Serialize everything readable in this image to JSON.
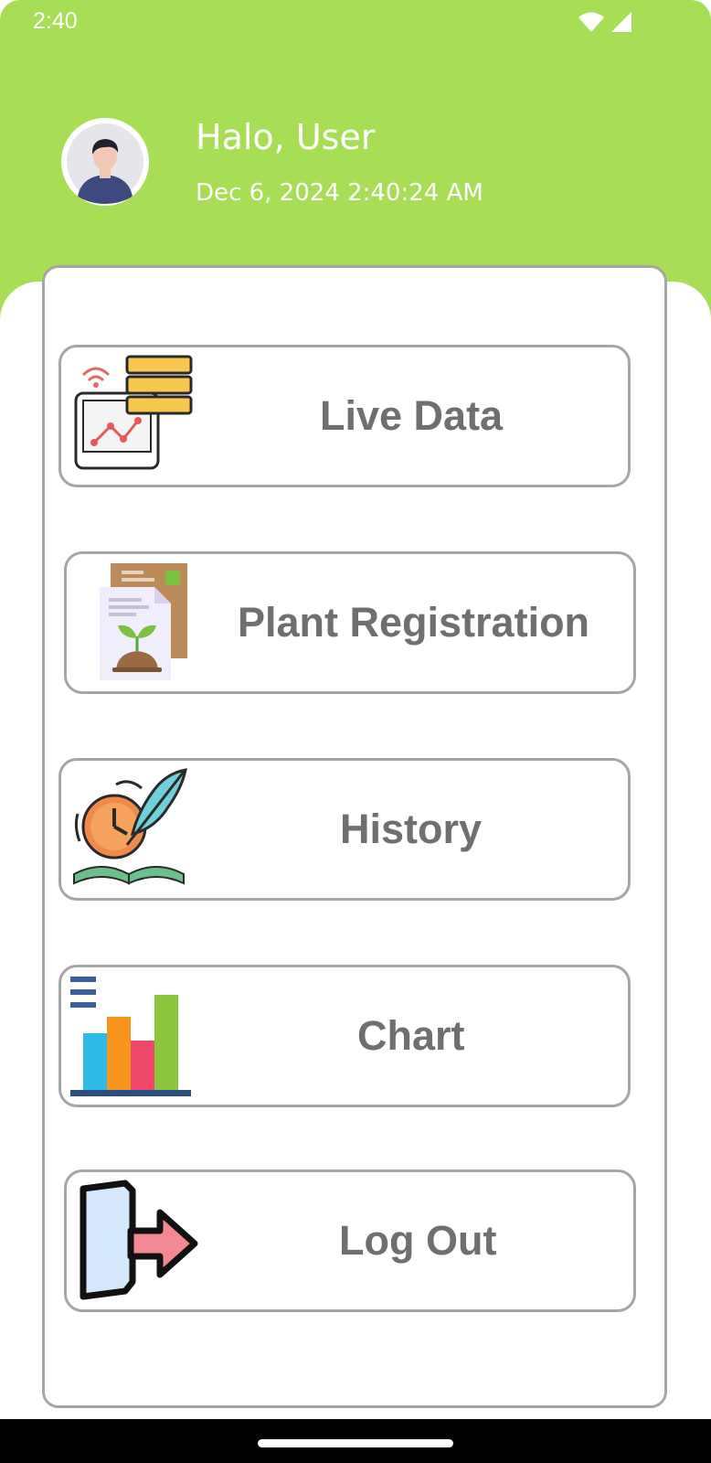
{
  "status_bar": {
    "time": "2:40",
    "icons": [
      "wifi-icon",
      "cellular-signal-icon"
    ]
  },
  "header": {
    "greeting": "Halo, User",
    "datetime": "Dec 6, 2024 2:40:24 AM",
    "avatar_icon": "user-avatar-icon"
  },
  "menu": {
    "items": [
      {
        "label": "Live Data",
        "icon": "live-data-icon"
      },
      {
        "label": "Plant Registration",
        "icon": "plant-registration-icon"
      },
      {
        "label": "History",
        "icon": "history-icon"
      },
      {
        "label": "Chart",
        "icon": "chart-icon"
      },
      {
        "label": "Log Out",
        "icon": "logout-icon"
      }
    ]
  },
  "colors": {
    "header_green": "#a8de55",
    "border_gray": "#a6a6a6",
    "label_gray": "#6f6f6f"
  }
}
